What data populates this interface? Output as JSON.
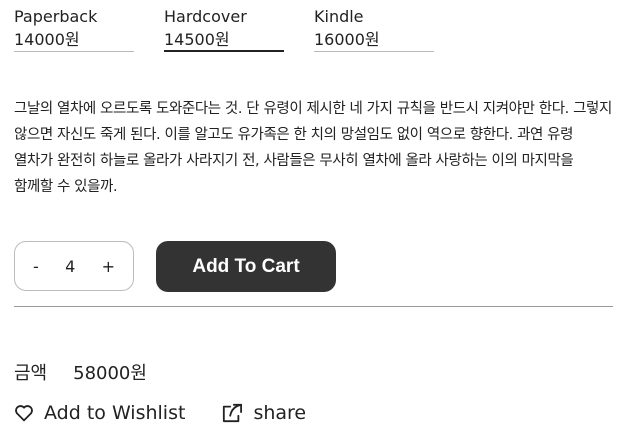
{
  "formats": [
    {
      "name": "Paperback",
      "price": "14000원"
    },
    {
      "name": "Hardcover",
      "price": "14500원"
    },
    {
      "name": "Kindle",
      "price": "16000원"
    }
  ],
  "selected_format": "Hardcover",
  "description": "그날의 열차에 오르도록 도와준다는 것. 단 유령이 제시한 네 가지 규칙을 반드시 지켜야만 한다. 그렇지 않으면 자신도 죽게 된다. 이를 알고도 유가족은 한 치의 망설임도 없이 역으로 향한다. 과연 유령 열차가 완전히 하늘로 올라가 사라지기 전, 사람들은 무사히 열차에 올라 사랑하는 이의 마지막을 함께할 수 있을까.",
  "quantity": {
    "minus": "-",
    "value": "4",
    "plus": "+"
  },
  "add_to_cart": "Add To Cart",
  "total": {
    "label": "금액",
    "value": "58000원"
  },
  "actions": {
    "wishlist": "Add to Wishlist",
    "share": "share"
  },
  "icons": {
    "wishlist": "heart-icon",
    "share": "share-icon"
  },
  "colors": {
    "button_bg": "#333333",
    "button_text": "#ffffff"
  }
}
